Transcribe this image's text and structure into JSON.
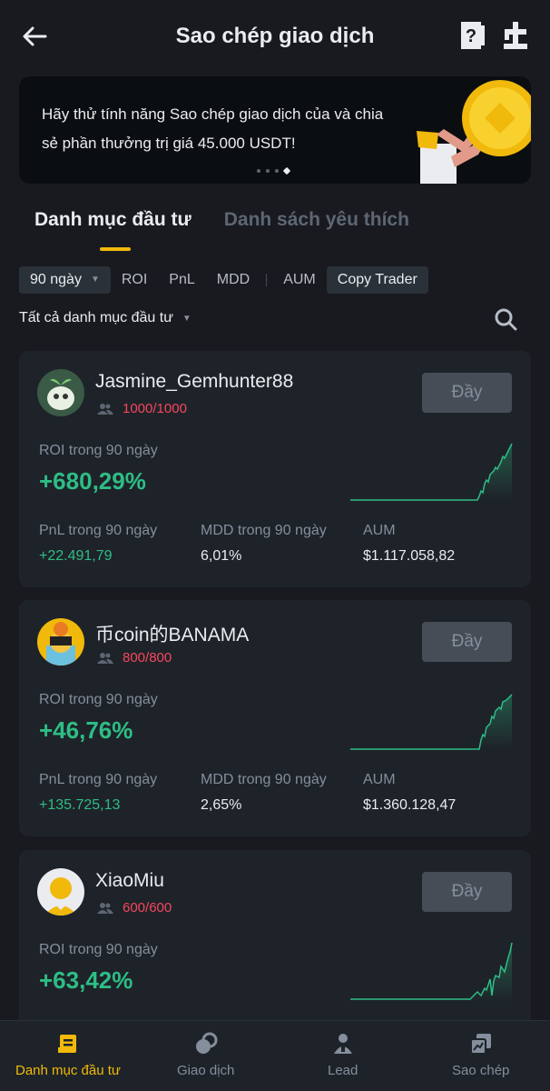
{
  "header": {
    "title": "Sao chép giao dịch"
  },
  "banner": {
    "text": "Hãy thử tính năng Sao chép giao dịch của và chia sẻ phần thưởng trị giá 45.000 USDT!"
  },
  "main_tabs": [
    {
      "label": "Danh mục đầu tư",
      "active": true
    },
    {
      "label": "Danh sách yêu thích",
      "active": false
    }
  ],
  "filters": {
    "period": "90 ngày",
    "options": [
      "ROI",
      "PnL",
      "MDD",
      "AUM",
      "Copy Trader"
    ],
    "selected_option": "Copy Trader"
  },
  "subfilter": {
    "label": "Tất cả danh mục đầu tư"
  },
  "cards": [
    {
      "name": "Jasmine_Gemhunter88",
      "followers": "1000/1000",
      "button": "Đầy",
      "roi_label": "ROI trong 90 ngày",
      "roi": "+680,29%",
      "pnl_label": "PnL trong 90 ngày",
      "pnl": "+22.491,79",
      "mdd_label": "MDD trong 90 ngày",
      "mdd": "6,01%",
      "aum_label": "AUM",
      "aum": "$1.117.058,82"
    },
    {
      "name": "币coin的BANAMA",
      "followers": "800/800",
      "button": "Đầy",
      "roi_label": "ROI trong 90 ngày",
      "roi": "+46,76%",
      "pnl_label": "PnL trong 90 ngày",
      "pnl": "+135.725,13",
      "mdd_label": "MDD trong 90 ngày",
      "mdd": "2,65%",
      "aum_label": "AUM",
      "aum": "$1.360.128,47"
    },
    {
      "name": "XiaoMiu",
      "followers": "600/600",
      "button": "Đầy",
      "roi_label": "ROI trong 90 ngày",
      "roi": "+63,42%"
    }
  ],
  "bottom_nav": [
    {
      "label": "Danh mục đầu tư",
      "icon": "portfolio-icon",
      "active": true
    },
    {
      "label": "Giao dịch",
      "icon": "trade-icon",
      "active": false
    },
    {
      "label": "Lead",
      "icon": "lead-icon",
      "active": false
    },
    {
      "label": "Sao chép",
      "icon": "copy-icon",
      "active": false
    }
  ],
  "colors": {
    "background": "#181a20",
    "card": "#1e2329",
    "accent": "#f0b90b",
    "positive": "#2ebd85",
    "negative": "#f6465d"
  }
}
